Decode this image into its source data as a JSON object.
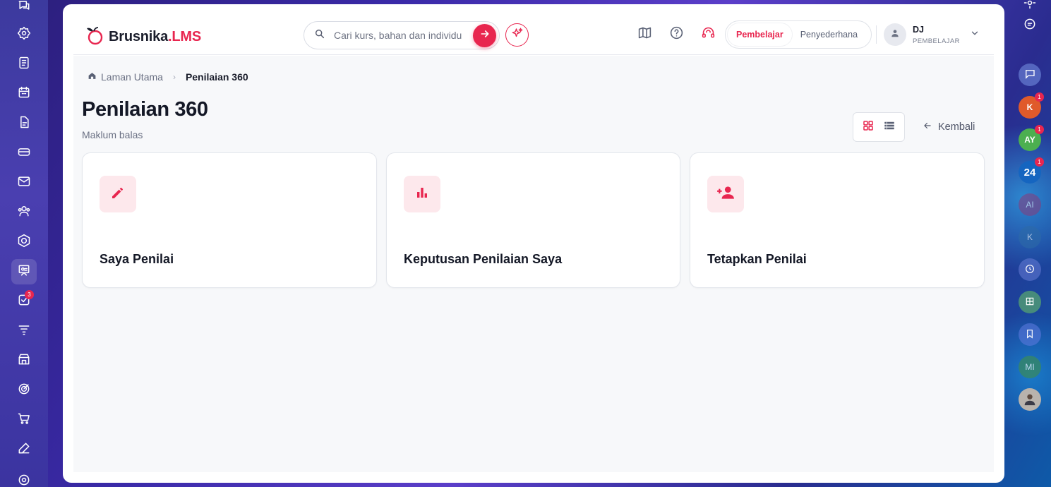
{
  "brand": {
    "name_main": "Brusnika",
    "name_suffix": ".LMS",
    "accent": "#e8264f"
  },
  "search": {
    "placeholder": "Cari kurs, bahan dan individu"
  },
  "header_icons": [
    "map-icon",
    "help-icon",
    "support-headset-icon"
  ],
  "roles": {
    "learner": "Pembelajar",
    "simplified": "Penyederhana",
    "active": "learner"
  },
  "user": {
    "initials": "DJ",
    "role": "PEMBELAJAR"
  },
  "left_rail": {
    "items": [
      {
        "icon": "chat-bubbles-icon",
        "badge": ""
      },
      {
        "icon": "settings-gear-icon"
      },
      {
        "icon": "document-list-icon"
      },
      {
        "icon": "calendar-icon"
      },
      {
        "icon": "file-icon"
      },
      {
        "icon": "card-icon"
      },
      {
        "icon": "mail-icon"
      },
      {
        "icon": "users-icon"
      },
      {
        "icon": "hexagon-icon"
      },
      {
        "icon": "presentation-icon",
        "active": true
      },
      {
        "icon": "checklist-icon",
        "badge": "3"
      },
      {
        "icon": "filter-funnel-icon"
      },
      {
        "icon": "store-icon"
      },
      {
        "icon": "target-icon"
      },
      {
        "icon": "cart-icon"
      },
      {
        "icon": "edit-pen-icon"
      },
      {
        "icon": "cog-icon"
      }
    ]
  },
  "right_rail": {
    "avatars": [
      {
        "label": "K",
        "badge": "1",
        "color": "#e05a2b"
      },
      {
        "label": "AY",
        "badge": "1",
        "color": "#4caf50"
      },
      {
        "label": "24",
        "badge": "1",
        "color": "#1565c0"
      },
      {
        "label": "AI",
        "color": "#8a3a7a"
      },
      {
        "label": "K",
        "color": "#2d6aa8"
      },
      {
        "label": "MI",
        "color": "#3a8a5a"
      }
    ]
  },
  "breadcrumb": {
    "home": "Laman Utama",
    "separator": "›",
    "current": "Penilaian 360"
  },
  "page": {
    "title": "Penilaian 360",
    "subtitle": "Maklum balas",
    "back_label": "Kembali"
  },
  "cards": [
    {
      "title": "Saya Penilai",
      "icon": "pencil-icon"
    },
    {
      "title": "Keputusan Penilaian Saya",
      "icon": "bar-chart-icon"
    },
    {
      "title": "Tetapkan Penilai",
      "icon": "add-user-icon"
    }
  ]
}
